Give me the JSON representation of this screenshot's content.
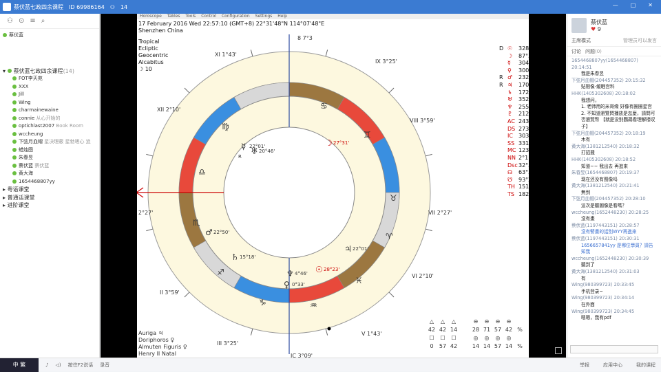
{
  "window": {
    "title": "蔡伏蓝七政四余课程",
    "id_label": "ID 69986164",
    "count": "14"
  },
  "left": {
    "room": "蔡伏蓝",
    "group": "蔡伏蓝七政四余课程",
    "group_count": "(14)",
    "members": [
      {
        "name": "FOT李天苑",
        "note": ""
      },
      {
        "name": "XXX",
        "note": ""
      },
      {
        "name": "Jill",
        "note": ""
      },
      {
        "name": "Wing",
        "note": ""
      },
      {
        "name": "charmainewaine",
        "note": ""
      },
      {
        "name": "connie",
        "note": "从心开始的"
      },
      {
        "name": "optichlast2007",
        "note": "Book Room"
      },
      {
        "name": "wccheung",
        "note": ""
      },
      {
        "name": "下弦月血帽",
        "note": "星决理蔽 星勃嗟心 追"
      },
      {
        "name": "蜡烛图",
        "note": ""
      },
      {
        "name": "朱春昱",
        "note": ""
      },
      {
        "name": "蔡伏蓝",
        "note": "蔡伏蓝"
      },
      {
        "name": "黄大海",
        "note": ""
      },
      {
        "name": "1654468807yy",
        "note": ""
      }
    ],
    "other_rooms": [
      "粤语课堂",
      "普通话课堂",
      "进阶课堂"
    ]
  },
  "screen": {
    "menu": [
      "Horoscope",
      "Tables",
      "Tools",
      "Control",
      "Configuration",
      "Settings",
      "Help"
    ],
    "chart_info": {
      "date": "17 February 2016  Wed  22:57:10 (GMT+8) 22°31'48\"N  114°07'48\"E",
      "place": "Shenzhen China",
      "zodiac": "Tropical",
      "coord": "Ecliptic",
      "centric": "Geocentric",
      "house": "Alcabitus",
      "moon_num": "10"
    },
    "planet_table": [
      [
        "D",
        "☉",
        "328°"
      ],
      [
        "",
        "☽",
        "87°3"
      ],
      [
        "",
        "☿",
        "304°"
      ],
      [
        "",
        "♀",
        "300°"
      ],
      [
        "R",
        "♂",
        "232°"
      ],
      [
        "R",
        "♃",
        "170°"
      ],
      [
        "",
        "♄",
        "172°"
      ],
      [
        "",
        "♅",
        "352°"
      ],
      [
        "",
        "♆",
        "255°"
      ],
      [
        "",
        "♇",
        "212°"
      ],
      [
        "",
        "AC",
        "243°"
      ],
      [
        "",
        "DS",
        "273°"
      ],
      [
        "",
        "IC",
        "303°"
      ],
      [
        "",
        "SS",
        "331°"
      ],
      [
        "",
        "MC",
        "123°"
      ],
      [
        "",
        "NN",
        "2°1"
      ],
      [
        "",
        "Dsc",
        "32°5"
      ],
      [
        "",
        "☊",
        "63°5"
      ],
      [
        "",
        "☋",
        "93°2"
      ],
      [
        "",
        "TH",
        "151°"
      ],
      [
        "",
        "TS",
        "182°"
      ]
    ],
    "house_labels": {
      "h10": "IX 3°25'",
      "h11": "XI 1°43'",
      "h12": "XII 2°10'",
      "h1": "I 2°27'",
      "h2": "II 3°59'",
      "h3": "III 3°25'",
      "h4": "IC 3°09'",
      "h5": "V 1°43'",
      "h6": "VI 2°10'",
      "h7": "VII 2°27'",
      "h8": "VIII 3°59'",
      "h9": "8 7°3"
    },
    "planet_labels": {
      "moon": "27°31'",
      "sun": "28°23'",
      "mars": "22°50'",
      "jupiter": "22°01'",
      "saturn": "15°18'",
      "neptune": "4°46'",
      "venus": "0°33'",
      "mercury": "22°01'",
      "r_label": "R",
      "node": "20°46'"
    },
    "bottom_left": [
      "Auriga  ♃",
      "Doriphoros  ♀",
      "Almuten Figuris  ♀",
      "Henry   II Natal"
    ],
    "aspect_grid": {
      "row1": [
        "42",
        "42",
        "14",
        "",
        "28",
        "71",
        "57",
        "42",
        "%"
      ],
      "row2": [
        "0",
        "57",
        "42",
        "",
        "14",
        "14",
        "57",
        "14",
        "%"
      ]
    }
  },
  "right": {
    "name": "蔡伏蓝",
    "likes": "9",
    "mode": "主席模式",
    "mode_note": "管理员可以发言",
    "tabs": [
      "讨论",
      "问题"
    ],
    "tab_count": "(0)",
    "chat": [
      {
        "u": "1654468807yy(1654468807) 20:14:51",
        "m": "我是朱春昱"
      },
      {
        "u": "下弦月血帽(204457352) 20:15:32",
        "m": "贴限像-缓眠宫料"
      },
      {
        "u": "HHK(1405302608) 20:18:02",
        "m": "我想问，"
      },
      {
        "u": "",
        "m": "1. 老师用的米哥缘 好像有圈圈星宫"
      },
      {
        "u": "",
        "m": "2. 不知道瀏覽閃播放是怎麼，請問可否瀏覽幣 【就是没别鸚鵡看理解楼叹子】"
      },
      {
        "u": "下弦月血帽(204457352) 20:18:19",
        "m": "木有"
      },
      {
        "u": "黄大海(1381212540) 20:18:32",
        "m": "打招擸"
      },
      {
        "u": "HHK(1405302608) 20:18:52",
        "m": "知道~~ 我出去 再進來"
      },
      {
        "u": "朱春昱(1654468807) 20:19:37",
        "m": "现在还没有图像吗"
      },
      {
        "u": "黄大海(1381212540) 20:21:41",
        "m": "無到"
      },
      {
        "u": "下弦月血帽(204457352) 20:28:10",
        "m": "這次是聽圖像是看嗎？"
      },
      {
        "u": "wccheung(1652448230) 20:28:25",
        "m": "沒有畫"
      },
      {
        "u": "蔡伏蓝(1197443151) 20:28:57",
        "m": "沒有譬畫的話別WYY再進來",
        "blue": true
      },
      {
        "u": "蔡伏蓝(1197443151) 20:30:31",
        "m": "1656657841yy 是哪位學員？請告知我",
        "blue": true
      },
      {
        "u": "wccheung(1652448230) 20:30:39",
        "m": "聽到了"
      },
      {
        "u": "黄大海(1381212540) 20:31:03",
        "m": "有"
      },
      {
        "u": "Wing(980399723) 20:33:45",
        "m": "手机登录~"
      },
      {
        "u": "Wing(980399723) 20:34:14",
        "m": "在外面"
      },
      {
        "u": "Wing(980399723) 20:34:45",
        "m": "嗯嗯，我有pdf"
      }
    ],
    "bottom": [
      "举报",
      "应用中心",
      "我的课程"
    ]
  },
  "status": {
    "thumb_text": "中 繁",
    "items": [
      "按住F2说话",
      "录音"
    ]
  },
  "colors": {
    "titlebar": "#3b7bd2",
    "fire": "#e8493b",
    "water": "#3a8fe0",
    "earth": "#9c7740",
    "air": "#d8d8d8"
  }
}
